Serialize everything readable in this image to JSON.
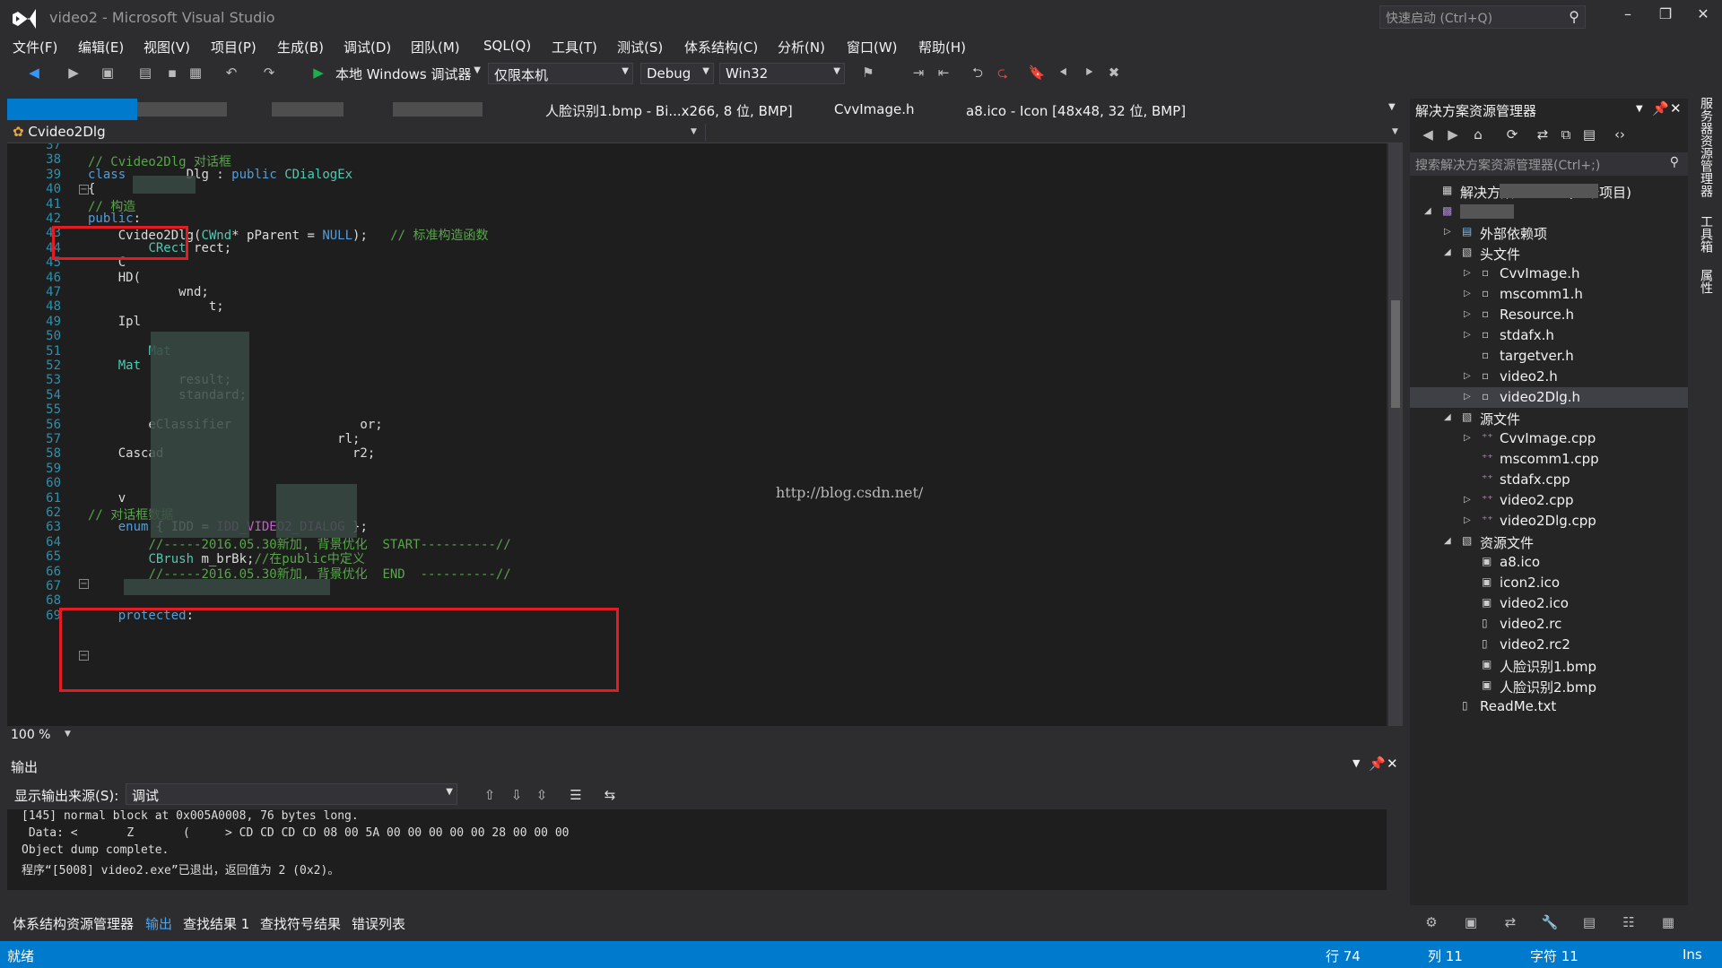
{
  "window": {
    "title": "video2 - Microsoft Visual Studio",
    "quick_launch": "快速启动 (Ctrl+Q)"
  },
  "menu": [
    "文件(F)",
    "编辑(E)",
    "视图(V)",
    "项目(P)",
    "生成(B)",
    "调试(D)",
    "团队(M)",
    "SQL(Q)",
    "工具(T)",
    "测试(S)",
    "体系结构(C)",
    "分析(N)",
    "窗口(W)",
    "帮助(H)"
  ],
  "toolbar": {
    "run_label": "本地 Windows 调试器",
    "target": "仅限本机",
    "config": "Debug",
    "platform": "Win32"
  },
  "tabs": [
    "人脸识别1.bmp - Bi...x266, 8 位, BMP]",
    "CvvImage.h",
    "a8.ico - Icon [48x48, 32 位, BMP]"
  ],
  "navbar": {
    "class": "Cvideo2Dlg"
  },
  "code_lines": [
    {
      "n": "37",
      "t": ""
    },
    {
      "n": "38",
      "t": "// Cvideo2Dlg 对话框"
    },
    {
      "n": "39",
      "t": "class        Dlg : public CDialogEx"
    },
    {
      "n": "40",
      "t": "{"
    },
    {
      "n": "41",
      "t": "// 构造"
    },
    {
      "n": "42",
      "t": "public:"
    },
    {
      "n": "43",
      "t": "    Cvideo2Dlg(CWnd* pParent = NULL);   // 标准构造函数"
    },
    {
      "n": "44",
      "t": "        CRect rect;"
    },
    {
      "n": "45",
      "t": "    C"
    },
    {
      "n": "46",
      "t": "    HD("
    },
    {
      "n": "47",
      "t": "            wnd;"
    },
    {
      "n": "48",
      "t": "                t;"
    },
    {
      "n": "49",
      "t": "    Ipl"
    },
    {
      "n": "50",
      "t": ""
    },
    {
      "n": "51",
      "t": "        Mat"
    },
    {
      "n": "52",
      "t": "    Mat"
    },
    {
      "n": "53",
      "t": "            result;"
    },
    {
      "n": "54",
      "t": "            standard;"
    },
    {
      "n": "55",
      "t": ""
    },
    {
      "n": "56",
      "t": "        eClassifier                 or;"
    },
    {
      "n": "57",
      "t": "                                 rl;"
    },
    {
      "n": "58",
      "t": "    Cascad                         r2;"
    },
    {
      "n": "59",
      "t": ""
    },
    {
      "n": "60",
      "t": ""
    },
    {
      "n": "61",
      "t": "    v"
    },
    {
      "n": "62",
      "t": "// 对话框数据"
    },
    {
      "n": "63",
      "t": "    enum { IDD = IDD_VIDEO2_DIALOG };"
    },
    {
      "n": "64",
      "t": "        //-----2016.05.30新加, 背景优化  START----------//"
    },
    {
      "n": "65",
      "t": "        CBrush m_brBk;//在public中定义"
    },
    {
      "n": "66",
      "t": "        //-----2016.05.30新加, 背景优化  END  ----------//"
    },
    {
      "n": "67",
      "t": ""
    },
    {
      "n": "68",
      "t": ""
    },
    {
      "n": "69",
      "t": "    protected:"
    }
  ],
  "watermark": "http://blog.csdn.net/",
  "zoom": "100 %",
  "output": {
    "title": "输出",
    "source_label": "显示输出来源(S):",
    "source_value": "调试",
    "lines": [
      "[145] normal block at 0x005A0008, 76 bytes long.",
      " Data: <       Z       (     > CD CD CD CD 08 00 5A 00 00 00 00 00 28 00 00 00",
      "Object dump complete.",
      "程序“[5008] video2.exe”已退出，返回值为 2 (0x2)。"
    ]
  },
  "bottom_tabs": [
    "体系结构资源管理器",
    "输出",
    "查找结果 1",
    "查找符号结果",
    "错误列表"
  ],
  "solution_explorer": {
    "title": "解决方案资源管理器",
    "search": "搜索解决方案资源管理器(Ctrl+;)",
    "items": [
      {
        "label": "解决方案",
        "suffix": "(1 个项目)",
        "level": 0,
        "exp": ""
      },
      {
        "label": "",
        "level": 0,
        "exp": "◢"
      },
      {
        "label": "外部依赖项",
        "level": 1,
        "exp": "▷"
      },
      {
        "label": "头文件",
        "level": 1,
        "exp": "◢"
      },
      {
        "label": "CvvImage.h",
        "level": 2,
        "exp": "▷"
      },
      {
        "label": "mscomm1.h",
        "level": 2,
        "exp": "▷"
      },
      {
        "label": "Resource.h",
        "level": 2,
        "exp": "▷"
      },
      {
        "label": "stdafx.h",
        "level": 2,
        "exp": "▷"
      },
      {
        "label": "targetver.h",
        "level": 2,
        "exp": ""
      },
      {
        "label": "video2.h",
        "level": 2,
        "exp": "▷"
      },
      {
        "label": "video2Dlg.h",
        "level": 2,
        "exp": "▷",
        "selected": true
      },
      {
        "label": "源文件",
        "level": 1,
        "exp": "◢"
      },
      {
        "label": "CvvImage.cpp",
        "level": 2,
        "exp": "▷"
      },
      {
        "label": "mscomm1.cpp",
        "level": 2,
        "exp": ""
      },
      {
        "label": "stdafx.cpp",
        "level": 2,
        "exp": ""
      },
      {
        "label": "video2.cpp",
        "level": 2,
        "exp": "▷"
      },
      {
        "label": "video2Dlg.cpp",
        "level": 2,
        "exp": "▷"
      },
      {
        "label": "资源文件",
        "level": 1,
        "exp": "◢"
      },
      {
        "label": "a8.ico",
        "level": 2,
        "exp": ""
      },
      {
        "label": "icon2.ico",
        "level": 2,
        "exp": ""
      },
      {
        "label": "video2.ico",
        "level": 2,
        "exp": ""
      },
      {
        "label": "video2.rc",
        "level": 2,
        "exp": ""
      },
      {
        "label": "video2.rc2",
        "level": 2,
        "exp": ""
      },
      {
        "label": "人脸识别1.bmp",
        "level": 2,
        "exp": ""
      },
      {
        "label": "人脸识别2.bmp",
        "level": 2,
        "exp": ""
      },
      {
        "label": "ReadMe.txt",
        "level": 1,
        "exp": ""
      }
    ]
  },
  "side_panels": [
    "服务器资源管理器",
    "工具箱",
    "属性"
  ],
  "status": {
    "ready": "就绪",
    "line": "行 74",
    "col": "列 11",
    "char": "字符 11",
    "ins": "Ins"
  },
  "colors": {
    "accent": "#007acc",
    "annotation": "#e31c23",
    "editor_bg": "#1e1e1e"
  }
}
